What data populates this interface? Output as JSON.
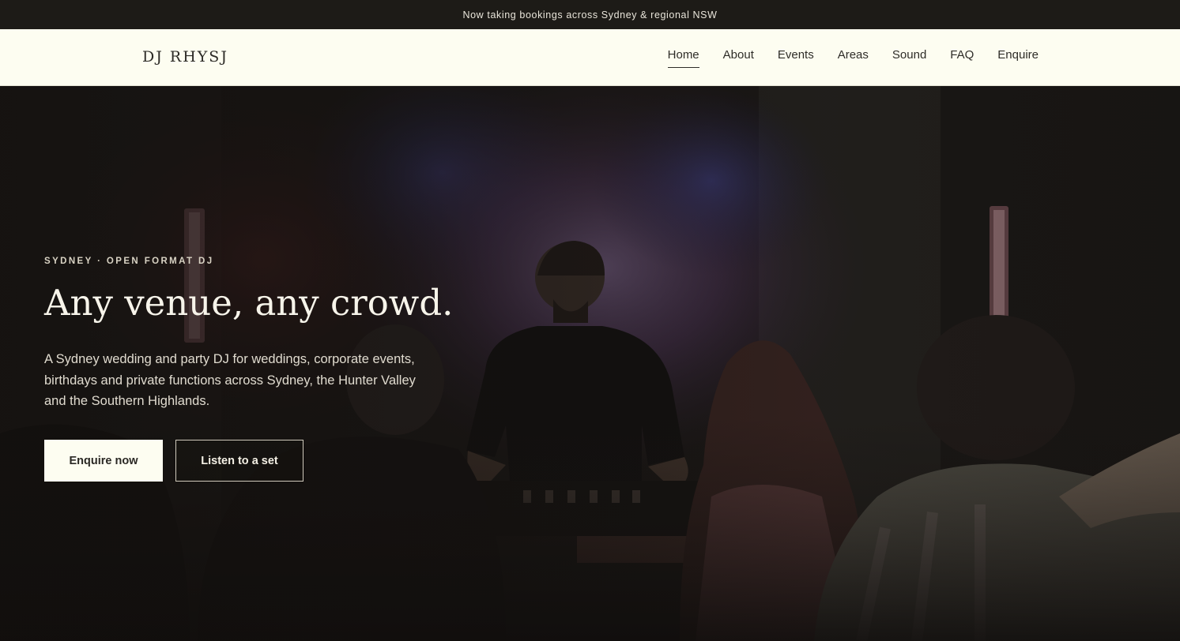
{
  "announcement": {
    "text": "Now taking bookings across Sydney & regional NSW"
  },
  "header": {
    "logo": "DJ RHYSJ",
    "nav": [
      {
        "label": "Home",
        "active": true
      },
      {
        "label": "About",
        "active": false
      },
      {
        "label": "Events",
        "active": false
      },
      {
        "label": "Areas",
        "active": false
      },
      {
        "label": "Sound",
        "active": false
      },
      {
        "label": "FAQ",
        "active": false
      },
      {
        "label": "Enquire",
        "active": false
      }
    ]
  },
  "hero": {
    "eyebrow": "SYDNEY · OPEN FORMAT DJ",
    "headline": "Any venue, any crowd.",
    "description": "A Sydney wedding and party DJ for weddings, corporate events, birthdays and private functions across Sydney, the Hunter Valley and the Southern Highlands.",
    "primary_cta": "Enquire now",
    "secondary_cta": "Listen to a set"
  },
  "colors": {
    "topbar_bg": "#1d1b17",
    "header_bg": "#fdfdf1",
    "text_dark": "#2e2c28",
    "button_light": "#fdfdf1"
  }
}
